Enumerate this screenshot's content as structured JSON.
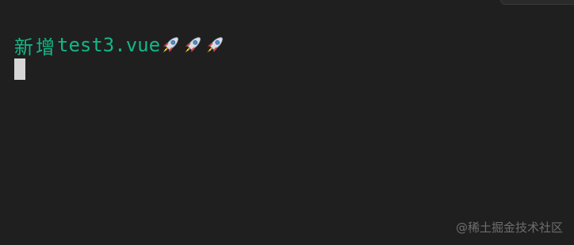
{
  "terminal": {
    "output": {
      "prefix": "新增",
      "filename": "test3.vue"
    },
    "icons": [
      "rocket-emoji",
      "rocket-emoji",
      "rocket-emoji"
    ]
  },
  "watermark": {
    "text": "@稀土掘金技术社区"
  },
  "colors": {
    "background": "#1f1f1f",
    "output_text": "#12b886",
    "cursor": "#d6d6d6",
    "watermark": "#6e6e6e"
  }
}
